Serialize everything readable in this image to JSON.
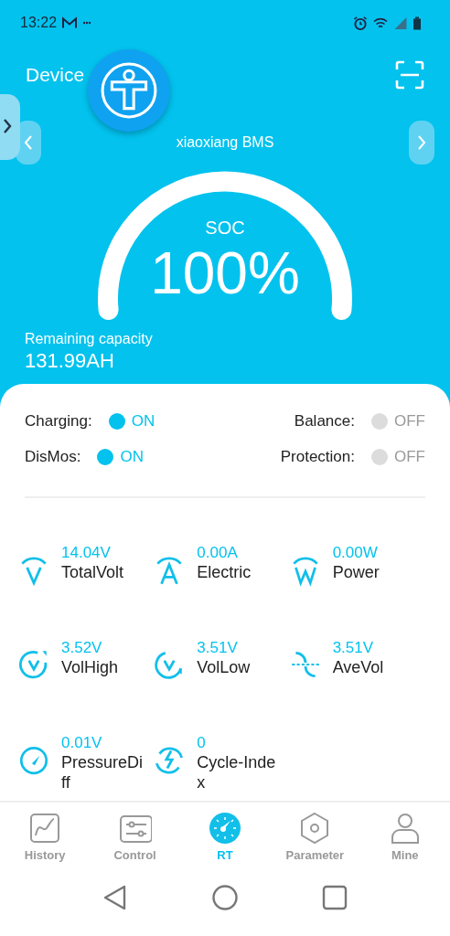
{
  "status_bar": {
    "time": "13:22"
  },
  "header": {
    "title": "Device",
    "device_name": "xiaoxiang BMS"
  },
  "gauge": {
    "label": "SOC",
    "reading": "100%"
  },
  "capacity": {
    "label": "Remaining capacity",
    "value": "131.99AH"
  },
  "switches": [
    {
      "label": "Charging:",
      "on": true,
      "state": "ON"
    },
    {
      "label": "Balance:",
      "on": false,
      "state": "OFF"
    },
    {
      "label": "DisMos:",
      "on": true,
      "state": "ON"
    },
    {
      "label": "Protection:",
      "on": false,
      "state": "OFF"
    }
  ],
  "metrics": [
    {
      "kind": "volt",
      "value": "14.04V",
      "label": "TotalVolt"
    },
    {
      "kind": "amp",
      "value": "0.00A",
      "label": "Electric"
    },
    {
      "kind": "watt",
      "value": "0.00W",
      "label": "Power"
    },
    {
      "kind": "high",
      "value": "3.52V",
      "label": "VolHigh"
    },
    {
      "kind": "low",
      "value": "3.51V",
      "label": "VolLow"
    },
    {
      "kind": "ave",
      "value": "3.51V",
      "label": "AveVol"
    },
    {
      "kind": "diff",
      "value": "0.01V",
      "label": "PressureDiff"
    },
    {
      "kind": "cycle",
      "value": "0",
      "label": "Cycle-Index"
    }
  ],
  "tabs": [
    {
      "kind": "history",
      "label": "History",
      "selected": false
    },
    {
      "kind": "control",
      "label": "Control",
      "selected": false
    },
    {
      "kind": "rt",
      "label": "RT",
      "selected": true
    },
    {
      "kind": "parameter",
      "label": "Parameter",
      "selected": false
    },
    {
      "kind": "mine",
      "label": "Mine",
      "selected": false
    }
  ]
}
